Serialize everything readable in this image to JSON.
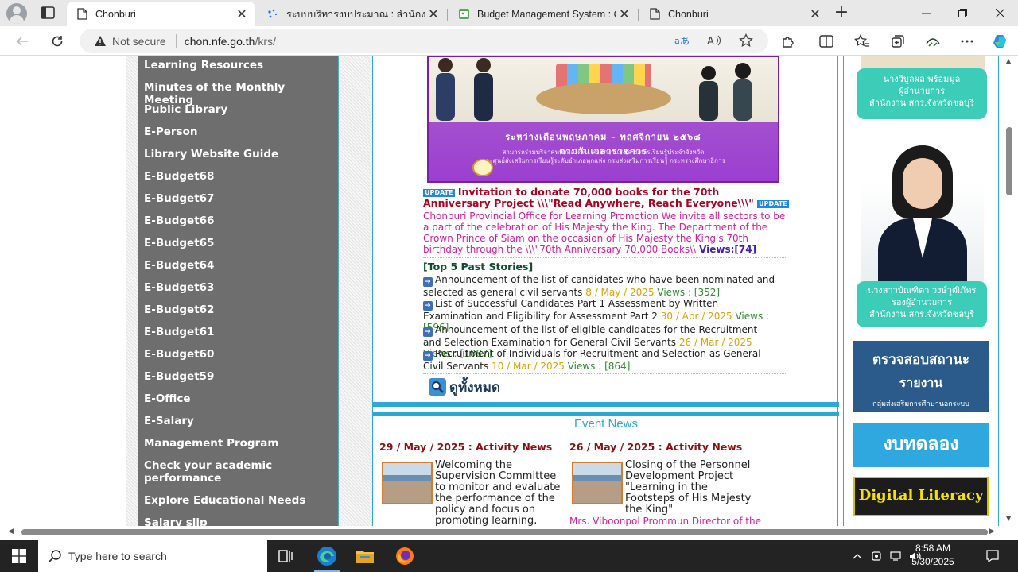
{
  "browser": {
    "tabs": [
      {
        "title": "Chonburi",
        "active": true
      },
      {
        "title": "ระบบบริหารงบประมาณ : สำนักงาน กศน",
        "active": false
      },
      {
        "title": "Budget Management System : Of",
        "active": false
      },
      {
        "title": "Chonburi",
        "active": false
      }
    ],
    "address": {
      "security_label": "Not secure",
      "host": "chon.nfe.go.th",
      "path": "/krs/"
    }
  },
  "left_menu": {
    "items": [
      "Learning Resources",
      "Minutes of the Monthly Meeting",
      "Public Library",
      "E-Person",
      "Library Website Guide",
      "E-Budget68",
      "E-Budget67",
      "E-Budget66",
      "E-Budget65",
      "E-Budget64",
      "E-Budget63",
      "E-Budget62",
      "E-Budget61",
      "E-Budget60",
      "E-Budget59",
      "E-Office",
      "E-Salary",
      "Management Program",
      "Check your academic performance",
      "Explore Educational Needs",
      "Salary slip"
    ]
  },
  "banner": {
    "line1": "ระหว่างเดือนพฤษภาคม – พฤศจิกายน ๒๕๖๘",
    "line1b": "ตามวันเวลาราชการ",
    "line2": "สามารถร่วมบริจาคหนังสือได้ที่ : สำนักงานส่งเสริมการเรียนรู้ประจำจังหวัด",
    "line3": "และศูนย์ส่งเสริมการเรียนรู้ระดับอำเภอทุกแห่ง  กรมส่งเสริมการเรียนรู้ กระทรวงศึกษาธิการ"
  },
  "headline": {
    "badge": "UPDATE",
    "title": "Invitation to donate 70,000 books for the 70th Anniversary Project \\\\\\\"Read Anywhere, Reach Everyone\\\\\\\"",
    "body": "Chonburi Provincial Office for Learning Promotion We invite all sectors to be a part of the celebration of His Majesty the King. The Department of the Crown Prince of Siam on the occasion of His Majesty the King's 70th birthday through the \\\\\\\"70th Anniversary 70,000 Books\\\\",
    "views_label": "Views:[74]"
  },
  "top_stories": {
    "heading": "[Top 5 Past Stories]",
    "items": [
      {
        "title": "Announcement of the list of candidates who have been nominated and selected as general civil servants",
        "date": "8 / May / 2025",
        "views": "Views : [352]"
      },
      {
        "title": "List of Successful Candidates Part 1 Assessment by Written Examination and Eligibility for Assessment Part 2",
        "date": "30 / Apr / 2025",
        "views": "Views : [596]"
      },
      {
        "title": "Announcement of the list of eligible candidates for the Recruitment and Selection Examination for General Civil Servants",
        "date": "26 / Mar / 2025",
        "views": "Views : [1087]"
      },
      {
        "title": "Recruitment of Individuals for Recruitment and Selection as General Civil Servants",
        "date": "10 / Mar / 2025",
        "views": "Views : [864]"
      }
    ],
    "view_all": "ดูทั้งหมด"
  },
  "events": {
    "title": "Event News",
    "items": [
      {
        "date": "29 / May / 2025 : Activity News",
        "text": "Welcoming the Supervision Committee to monitor and evaluate the performance of the policy and focus on promoting learning."
      },
      {
        "date": "26 / May / 2025 : Activity News",
        "text": "Closing of the Personnel Development Project \"Learning in the Footsteps of His Majesty the King\"",
        "more": "Mrs. Viboonpol Prommun Director of the"
      }
    ]
  },
  "right_column": {
    "card1": [
      "นางวิบูลผล  พร้อมมูล",
      "ผู้อำนวยการ",
      "สำนักงาน สกร.จังหวัดชลบุรี"
    ],
    "card2": [
      "นางสาวบัณฑิตา วงษ์วุฒิภัทร",
      "รองผู้อำนวยการ",
      "สำนักงาน สกร.จังหวัดชลบุรี"
    ],
    "banner1": [
      "ตรวจสอบสถานะ",
      "รายงาน",
      "กลุ่มส่งเสริมการศึกษานอกระบบ"
    ],
    "banner2": "งบทดลอง",
    "banner3": "Digital Literacy"
  },
  "taskbar": {
    "search_placeholder": "Type here to search",
    "time": "8:58 AM",
    "date": "5/30/2025"
  },
  "colors": {
    "menu_bg": "#6e6e6e",
    "accent": "#2aa8d6",
    "headline_red": "#b00020",
    "body_magenta": "#d81b9b"
  }
}
